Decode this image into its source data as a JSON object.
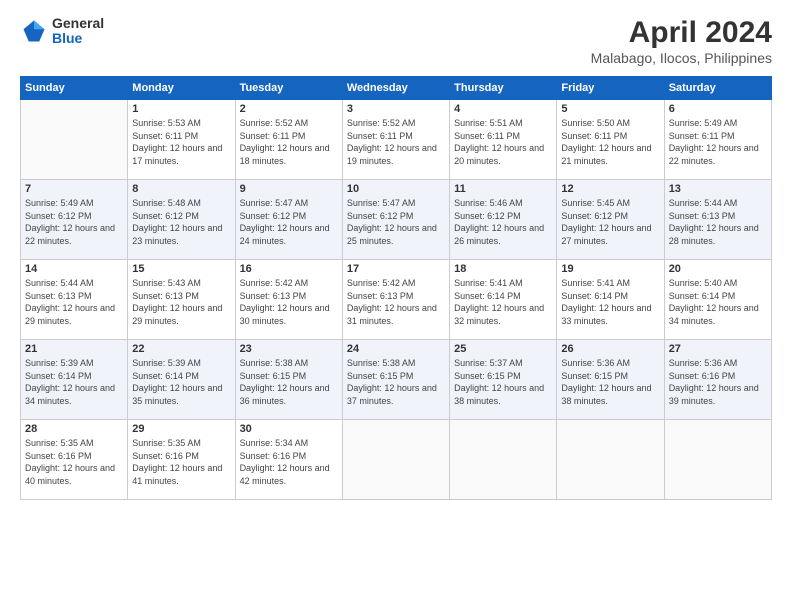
{
  "logo": {
    "general": "General",
    "blue": "Blue"
  },
  "header": {
    "month": "April 2024",
    "location": "Malabago, Ilocos, Philippines"
  },
  "weekdays": [
    "Sunday",
    "Monday",
    "Tuesday",
    "Wednesday",
    "Thursday",
    "Friday",
    "Saturday"
  ],
  "weeks": [
    [
      {
        "day": "",
        "empty": true
      },
      {
        "day": "1",
        "sunrise": "Sunrise: 5:53 AM",
        "sunset": "Sunset: 6:11 PM",
        "daylight": "Daylight: 12 hours and 17 minutes."
      },
      {
        "day": "2",
        "sunrise": "Sunrise: 5:52 AM",
        "sunset": "Sunset: 6:11 PM",
        "daylight": "Daylight: 12 hours and 18 minutes."
      },
      {
        "day": "3",
        "sunrise": "Sunrise: 5:52 AM",
        "sunset": "Sunset: 6:11 PM",
        "daylight": "Daylight: 12 hours and 19 minutes."
      },
      {
        "day": "4",
        "sunrise": "Sunrise: 5:51 AM",
        "sunset": "Sunset: 6:11 PM",
        "daylight": "Daylight: 12 hours and 20 minutes."
      },
      {
        "day": "5",
        "sunrise": "Sunrise: 5:50 AM",
        "sunset": "Sunset: 6:11 PM",
        "daylight": "Daylight: 12 hours and 21 minutes."
      },
      {
        "day": "6",
        "sunrise": "Sunrise: 5:49 AM",
        "sunset": "Sunset: 6:11 PM",
        "daylight": "Daylight: 12 hours and 22 minutes."
      }
    ],
    [
      {
        "day": "7",
        "sunrise": "Sunrise: 5:49 AM",
        "sunset": "Sunset: 6:12 PM",
        "daylight": "Daylight: 12 hours and 22 minutes."
      },
      {
        "day": "8",
        "sunrise": "Sunrise: 5:48 AM",
        "sunset": "Sunset: 6:12 PM",
        "daylight": "Daylight: 12 hours and 23 minutes."
      },
      {
        "day": "9",
        "sunrise": "Sunrise: 5:47 AM",
        "sunset": "Sunset: 6:12 PM",
        "daylight": "Daylight: 12 hours and 24 minutes."
      },
      {
        "day": "10",
        "sunrise": "Sunrise: 5:47 AM",
        "sunset": "Sunset: 6:12 PM",
        "daylight": "Daylight: 12 hours and 25 minutes."
      },
      {
        "day": "11",
        "sunrise": "Sunrise: 5:46 AM",
        "sunset": "Sunset: 6:12 PM",
        "daylight": "Daylight: 12 hours and 26 minutes."
      },
      {
        "day": "12",
        "sunrise": "Sunrise: 5:45 AM",
        "sunset": "Sunset: 6:12 PM",
        "daylight": "Daylight: 12 hours and 27 minutes."
      },
      {
        "day": "13",
        "sunrise": "Sunrise: 5:44 AM",
        "sunset": "Sunset: 6:13 PM",
        "daylight": "Daylight: 12 hours and 28 minutes."
      }
    ],
    [
      {
        "day": "14",
        "sunrise": "Sunrise: 5:44 AM",
        "sunset": "Sunset: 6:13 PM",
        "daylight": "Daylight: 12 hours and 29 minutes."
      },
      {
        "day": "15",
        "sunrise": "Sunrise: 5:43 AM",
        "sunset": "Sunset: 6:13 PM",
        "daylight": "Daylight: 12 hours and 29 minutes."
      },
      {
        "day": "16",
        "sunrise": "Sunrise: 5:42 AM",
        "sunset": "Sunset: 6:13 PM",
        "daylight": "Daylight: 12 hours and 30 minutes."
      },
      {
        "day": "17",
        "sunrise": "Sunrise: 5:42 AM",
        "sunset": "Sunset: 6:13 PM",
        "daylight": "Daylight: 12 hours and 31 minutes."
      },
      {
        "day": "18",
        "sunrise": "Sunrise: 5:41 AM",
        "sunset": "Sunset: 6:14 PM",
        "daylight": "Daylight: 12 hours and 32 minutes."
      },
      {
        "day": "19",
        "sunrise": "Sunrise: 5:41 AM",
        "sunset": "Sunset: 6:14 PM",
        "daylight": "Daylight: 12 hours and 33 minutes."
      },
      {
        "day": "20",
        "sunrise": "Sunrise: 5:40 AM",
        "sunset": "Sunset: 6:14 PM",
        "daylight": "Daylight: 12 hours and 34 minutes."
      }
    ],
    [
      {
        "day": "21",
        "sunrise": "Sunrise: 5:39 AM",
        "sunset": "Sunset: 6:14 PM",
        "daylight": "Daylight: 12 hours and 34 minutes."
      },
      {
        "day": "22",
        "sunrise": "Sunrise: 5:39 AM",
        "sunset": "Sunset: 6:14 PM",
        "daylight": "Daylight: 12 hours and 35 minutes."
      },
      {
        "day": "23",
        "sunrise": "Sunrise: 5:38 AM",
        "sunset": "Sunset: 6:15 PM",
        "daylight": "Daylight: 12 hours and 36 minutes."
      },
      {
        "day": "24",
        "sunrise": "Sunrise: 5:38 AM",
        "sunset": "Sunset: 6:15 PM",
        "daylight": "Daylight: 12 hours and 37 minutes."
      },
      {
        "day": "25",
        "sunrise": "Sunrise: 5:37 AM",
        "sunset": "Sunset: 6:15 PM",
        "daylight": "Daylight: 12 hours and 38 minutes."
      },
      {
        "day": "26",
        "sunrise": "Sunrise: 5:36 AM",
        "sunset": "Sunset: 6:15 PM",
        "daylight": "Daylight: 12 hours and 38 minutes."
      },
      {
        "day": "27",
        "sunrise": "Sunrise: 5:36 AM",
        "sunset": "Sunset: 6:16 PM",
        "daylight": "Daylight: 12 hours and 39 minutes."
      }
    ],
    [
      {
        "day": "28",
        "sunrise": "Sunrise: 5:35 AM",
        "sunset": "Sunset: 6:16 PM",
        "daylight": "Daylight: 12 hours and 40 minutes."
      },
      {
        "day": "29",
        "sunrise": "Sunrise: 5:35 AM",
        "sunset": "Sunset: 6:16 PM",
        "daylight": "Daylight: 12 hours and 41 minutes."
      },
      {
        "day": "30",
        "sunrise": "Sunrise: 5:34 AM",
        "sunset": "Sunset: 6:16 PM",
        "daylight": "Daylight: 12 hours and 42 minutes."
      },
      {
        "day": "",
        "empty": true
      },
      {
        "day": "",
        "empty": true
      },
      {
        "day": "",
        "empty": true
      },
      {
        "day": "",
        "empty": true
      }
    ]
  ]
}
